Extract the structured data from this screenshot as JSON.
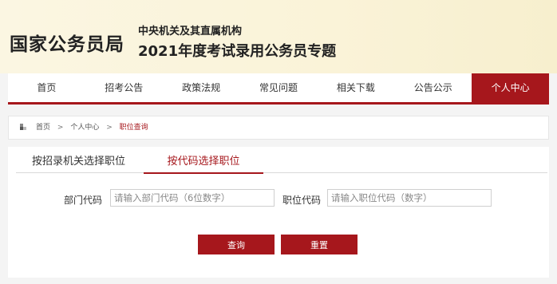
{
  "header": {
    "logo": "国家公务员局",
    "subtitle_line1": "中央机关及其直属机构",
    "subtitle_line2": "2021年度考试录用公务员专题"
  },
  "nav": {
    "items": [
      {
        "label": "首页"
      },
      {
        "label": "招考公告"
      },
      {
        "label": "政策法规"
      },
      {
        "label": "常见问题"
      },
      {
        "label": "相关下载"
      },
      {
        "label": "公告公示"
      },
      {
        "label": "个人中心"
      }
    ],
    "active_index": 6
  },
  "breadcrumb": {
    "items": [
      "首页",
      "个人中心",
      "职位查询"
    ],
    "separator": ">"
  },
  "tabs": [
    {
      "label": "按招录机关选择职位"
    },
    {
      "label": "按代码选择职位"
    }
  ],
  "form": {
    "dept_label": "部门代码",
    "dept_placeholder": "请输入部门代码（6位数字）",
    "position_label": "职位代码",
    "position_placeholder": "请输入职位代码（数字）",
    "query_button": "查询",
    "reset_button": "重置"
  },
  "colors": {
    "accent": "#a6171c",
    "header_bg": "#fbf6e2"
  }
}
